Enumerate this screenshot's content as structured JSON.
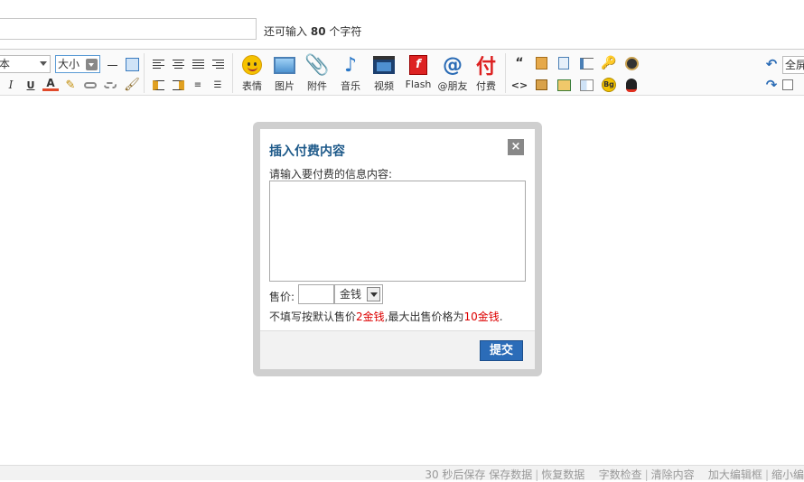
{
  "title_row": {
    "hint_prefix": "还可输入",
    "hint_count": "80",
    "hint_suffix": "个字符"
  },
  "toolbar": {
    "font_value": "本",
    "size_value": "大小",
    "buttons": [
      {
        "label": "表情",
        "icon": "smiley-icon"
      },
      {
        "label": "图片",
        "icon": "image-icon"
      },
      {
        "label": "附件",
        "icon": "paperclip-icon"
      },
      {
        "label": "音乐",
        "icon": "music-note-icon"
      },
      {
        "label": "视频",
        "icon": "film-icon"
      },
      {
        "label": "Flash",
        "icon": "flash-icon"
      },
      {
        "label": "@朋友",
        "icon": "at-icon"
      },
      {
        "label": "付费",
        "icon": "pay-icon"
      }
    ],
    "pay_glyph": "付",
    "fullscreen_label": "全屏"
  },
  "modal": {
    "title": "插入付费内容",
    "close": "×",
    "content_label": "请输入要付费的信息内容:",
    "price_label": "售价:",
    "currency": "金钱",
    "note_1": "不填写按默认售价",
    "note_default_price": "2金钱",
    "note_2": ",最大出售价格为",
    "note_max_price": "10金钱",
    "note_3": ".",
    "submit": "提交"
  },
  "statusbar": {
    "autosave": "30 秒后保存",
    "save_data": "保存数据",
    "restore_data": "恢复数据",
    "check_length": "字数检查",
    "clear_content": "清除内容",
    "enlarge_editor": "加大编辑框",
    "shrink_editor": "缩小编"
  },
  "colors": {
    "accent": "#2b6cb8",
    "modal_title": "#1e5a8a",
    "price_highlight": "#dd0000"
  }
}
